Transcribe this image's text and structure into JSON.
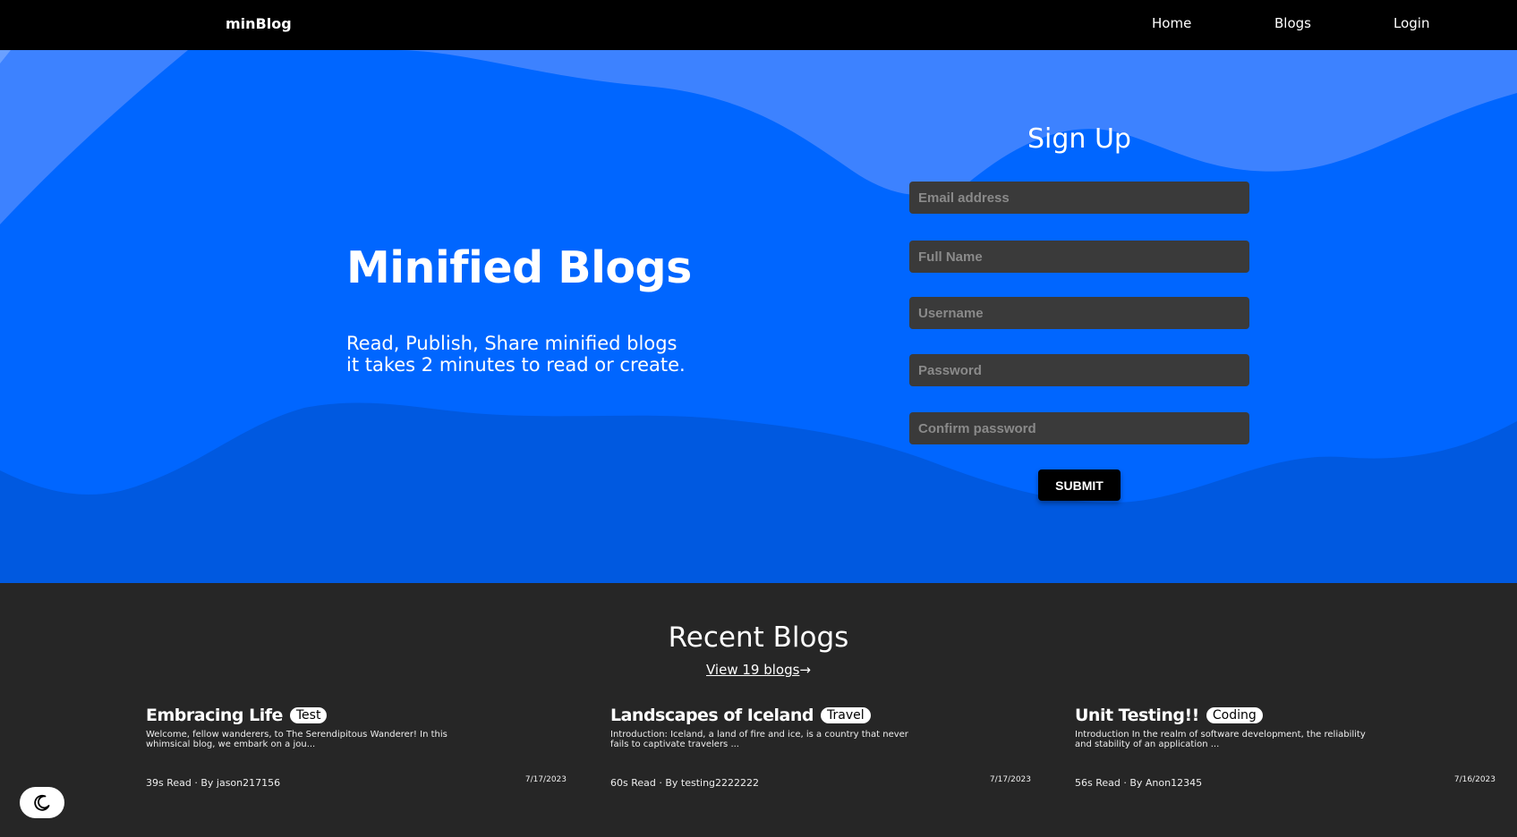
{
  "nav": {
    "brand": "minBlog",
    "links": [
      "Home",
      "Blogs",
      "Login"
    ]
  },
  "hero": {
    "title": "Minified Blogs",
    "subtitle_line1": "Read, Publish, Share minified blogs",
    "subtitle_line2": "it takes 2 minutes to read or create."
  },
  "signup": {
    "title": "Sign Up",
    "email_placeholder": "Email address",
    "fullname_placeholder": "Full Name",
    "username_placeholder": "Username",
    "password_placeholder": "Password",
    "confirm_placeholder": "Confirm password",
    "submit_label": "SUBMIT"
  },
  "recent": {
    "title": "Recent Blogs",
    "view_link": "View 19 blogs",
    "arrow": "→",
    "blogs": [
      {
        "title": "Embracing Life",
        "tag": "Test",
        "excerpt": "Welcome, fellow wanderers, to The Serendipitous Wanderer! In this whimsical blog, we embark on a jou...",
        "meta": "39s Read · By jason217156",
        "date": "7/17/2023"
      },
      {
        "title": "Landscapes of Iceland",
        "tag": "Travel",
        "excerpt": "Introduction: Iceland, a land of fire and ice, is a country that never fails to captivate travelers ...",
        "meta": "60s Read · By testing2222222",
        "date": "7/17/2023"
      },
      {
        "title": "Unit Testing!!",
        "tag": "Coding",
        "excerpt": "Introduction In the realm of software development, the reliability and stability of an application ...",
        "meta": "56s Read · By Anon12345",
        "date": "7/16/2023"
      }
    ]
  },
  "theme_toggle": {
    "icon": "moon-icon"
  },
  "colors": {
    "nav_bg": "#000000",
    "hero_bg": "#0066ff",
    "wave_light": "#3d82ff",
    "wave_dark": "#0059e0",
    "page_bg": "#262626",
    "input_bg": "#3a3a3a"
  }
}
